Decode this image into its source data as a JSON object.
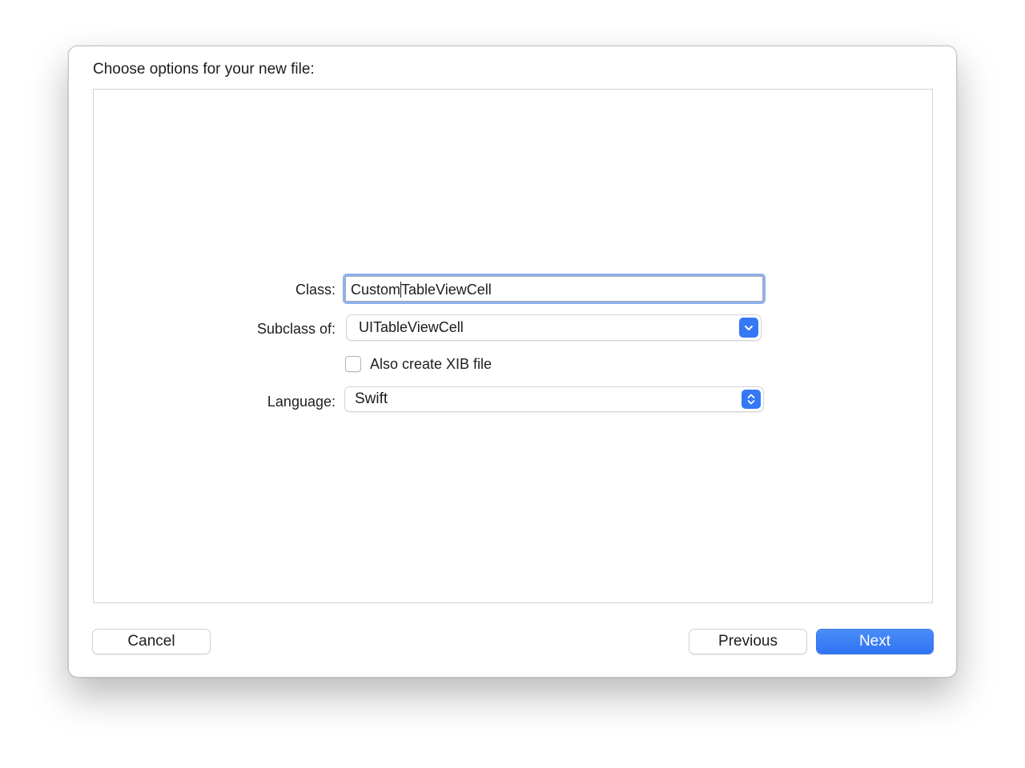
{
  "dialog": {
    "title": "Choose options for your new file:"
  },
  "form": {
    "class_label": "Class:",
    "class_value_before_cursor": "Custom",
    "class_value_after_cursor": "TableViewCell",
    "subclass_label": "Subclass of:",
    "subclass_value": "UITableViewCell",
    "xib_checkbox_label": "Also create XIB file",
    "xib_checked": false,
    "language_label": "Language:",
    "language_value": "Swift"
  },
  "buttons": {
    "cancel": "Cancel",
    "previous": "Previous",
    "next": "Next"
  },
  "icons": {
    "subclass_popup": "chevron-down-icon",
    "language_popup": "up-down-chevron-icon"
  },
  "colors": {
    "accent": "#3478f6",
    "focus_ring": "#8db1f0"
  }
}
